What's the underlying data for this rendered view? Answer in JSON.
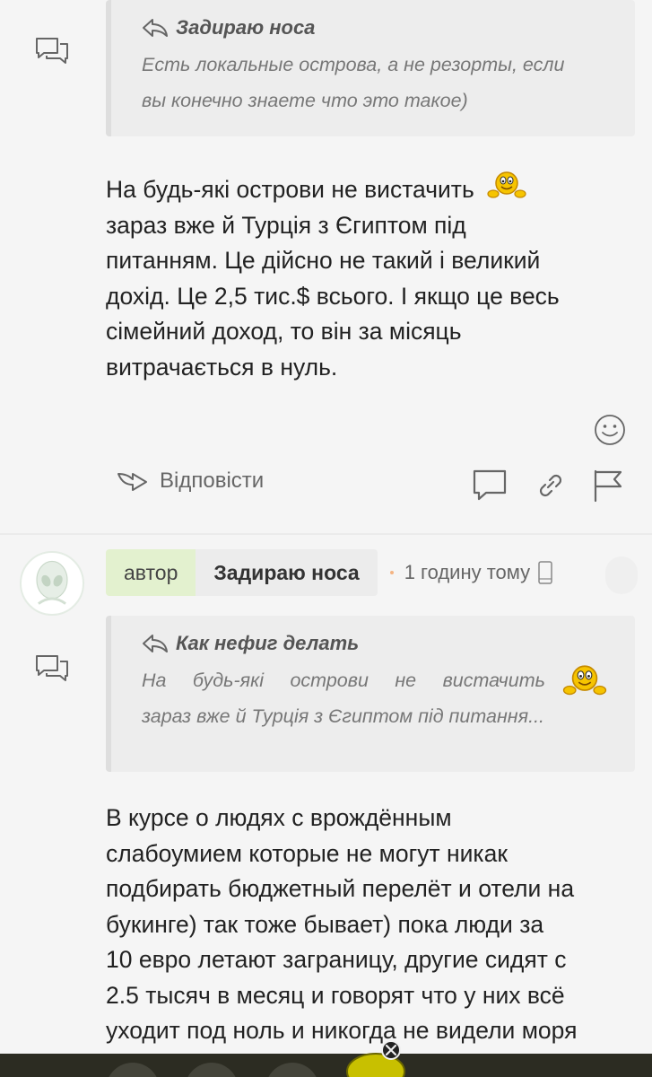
{
  "comments": [
    {
      "quote": {
        "author": "Задираю носа",
        "lines": [
          "Есть локальные острова, а не резорты, если",
          "вы конечно знаете что это такое)"
        ]
      },
      "body_lines": [
        "На будь-які острови не вистачить",
        "зараз вже й Турція з Єгиптом під",
        "питанням. Це дійсно не такий і великий",
        "дохід. Це 2,5 тис.$ всього. І якщо це весь",
        "сімейний доход, то він за місяць",
        "витрачається в нуль."
      ],
      "reply_label": "Відповісти"
    },
    {
      "badge": "автор",
      "author": "Задираю носа",
      "time": "1 годину тому",
      "quote": {
        "author": "Как нефиг делать",
        "lines": [
          "На будь-які острови не вистачить",
          "зараз вже й Турція з Єгиптом під питання..."
        ]
      },
      "body_lines": [
        "В курсе о людях с врождённым",
        "слабоумием которые не могут никак",
        "подбирать бюджетный перелёт и отели на",
        "букинге) так тоже бывает) пока люди за",
        "10 евро летают заграницу, другие сидят с",
        "2.5 тысяч в месяц и говорят что у них всё",
        "уходит под ноль и никогда не видели моря"
      ]
    }
  ],
  "icons": {
    "side": "chat-bubbles-icon",
    "quote": "reply-arrow-icon",
    "emoji": "smiley-face-icon",
    "reply": "reply-arrow-icon",
    "comment": "comment-icon",
    "link": "link-icon",
    "flag": "flag-icon",
    "avatar": "alien-avatar",
    "phone": "phone-icon"
  },
  "colors": {
    "badge_bg": "#e3f1cf",
    "quote_bg": "#ededed",
    "background": "#f5f5f5"
  }
}
